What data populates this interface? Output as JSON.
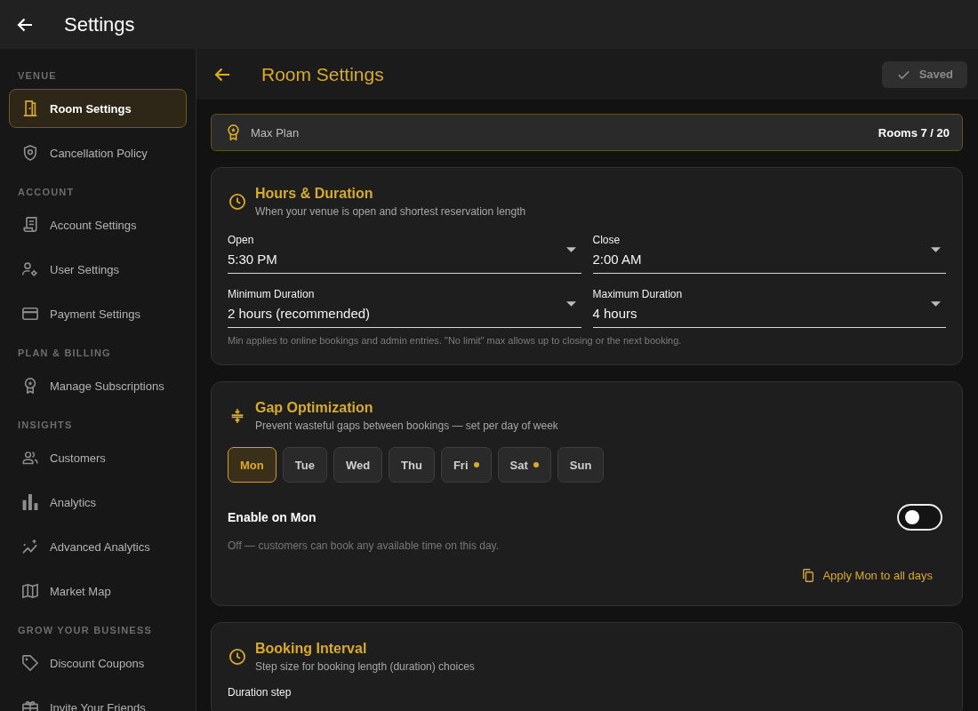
{
  "app_bar": {
    "title": "Settings"
  },
  "sidebar": {
    "sections": [
      {
        "heading": "VENUE",
        "items": [
          {
            "label": "Room Settings",
            "selected": true
          },
          {
            "label": "Cancellation Policy",
            "selected": false
          }
        ]
      },
      {
        "heading": "ACCOUNT",
        "items": [
          {
            "label": "Account Settings",
            "selected": false
          },
          {
            "label": "User Settings",
            "selected": false
          },
          {
            "label": "Payment Settings",
            "selected": false
          }
        ]
      },
      {
        "heading": "PLAN & BILLING",
        "items": [
          {
            "label": "Manage Subscriptions",
            "selected": false
          }
        ]
      },
      {
        "heading": "INSIGHTS",
        "items": [
          {
            "label": "Customers",
            "selected": false
          },
          {
            "label": "Analytics",
            "selected": false
          },
          {
            "label": "Advanced Analytics",
            "selected": false
          },
          {
            "label": "Market Map",
            "selected": false
          }
        ]
      },
      {
        "heading": "GROW YOUR BUSINESS",
        "items": [
          {
            "label": "Discount Coupons",
            "selected": false
          },
          {
            "label": "Invite Your Friends",
            "selected": false
          }
        ]
      }
    ]
  },
  "page_header": {
    "title": "Room Settings",
    "save_button": {
      "label": "Saved",
      "disabled": true
    }
  },
  "plan_banner": {
    "plan": "Max Plan",
    "usage": "Rooms 7 / 20"
  },
  "cards": [
    {
      "kind": "fields",
      "title": "Hours & Duration",
      "subtitle": "When your venue is open and shortest reservation length",
      "fields": [
        {
          "label": "Open",
          "value": "5:30 PM"
        },
        {
          "label": "Close",
          "value": "2:00 AM"
        },
        {
          "label": "Minimum Duration",
          "value": "2 hours (recommended)"
        },
        {
          "label": "Maximum Duration",
          "value": "4 hours"
        }
      ],
      "note": "Min applies to online bookings and admin entries. \"No limit\" max allows up to closing or the next booking."
    },
    {
      "kind": "days",
      "title": "Gap Optimization",
      "subtitle": "Prevent wasteful gaps between bookings — set per day of week",
      "days": [
        {
          "label": "Mon",
          "selected": true,
          "enabled": false
        },
        {
          "label": "Tue",
          "selected": false,
          "enabled": false
        },
        {
          "label": "Wed",
          "selected": false,
          "enabled": false
        },
        {
          "label": "Thu",
          "selected": false,
          "enabled": false
        },
        {
          "label": "Fri",
          "selected": false,
          "enabled": true
        },
        {
          "label": "Sat",
          "selected": false,
          "enabled": true
        },
        {
          "label": "Sun",
          "selected": false,
          "enabled": false
        }
      ],
      "toggle": {
        "label": "Enable on Mon",
        "on": false
      },
      "description": "Off — customers can book any available time on this day.",
      "apply_link": "Apply Mon to all days"
    },
    {
      "kind": "fields",
      "title": "Booking Interval",
      "subtitle": "Step size for booking length (duration) choices",
      "fields": [
        {
          "label": "Duration step"
        }
      ]
    }
  ]
}
